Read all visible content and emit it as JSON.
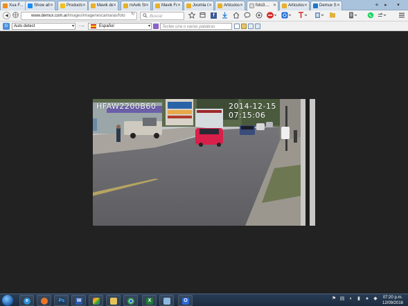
{
  "tabs": [
    {
      "label": "Xua F...",
      "color": "#f28c1c"
    },
    {
      "label": "Show all ...",
      "color": "#1c8cf2"
    },
    {
      "label": "Products",
      "color": "#f2c01c"
    },
    {
      "label": "Mavik del...",
      "color": "#e8b02a"
    },
    {
      "label": "mAvik St...",
      "color": "#e8b02a"
    },
    {
      "label": "Mavik For...",
      "color": "#e8b02a"
    },
    {
      "label": "Joomla G...",
      "color": "#e8b02a"
    },
    {
      "label": "Articulos:...",
      "color": "#e8b02a"
    },
    {
      "label": "foto3....",
      "color": "#f0f0f0",
      "active": true
    },
    {
      "label": "Articulos:...",
      "color": "#e8b02a"
    },
    {
      "label": "Demux S...",
      "color": "#1a78c8"
    }
  ],
  "tab_new": "+",
  "tab_scroll": "▸",
  "tab_menu": "▾",
  "nav": {
    "back": "◀",
    "url_host": "www.demux.com.ar",
    "url_path": "/images/imagenescamaras/foto",
    "reload": "↻",
    "search_placeholder": "Buscar"
  },
  "translate": {
    "logo": "G",
    "source_language": "Auto detect",
    "arrow": "→",
    "target_language": "Español",
    "input_placeholder": "Teclee una o varias palabras"
  },
  "photo_overlay": {
    "camera_id": "HFAW2200B60",
    "timestamp": "2014-12-15 07:15:06"
  },
  "tray": {
    "time": "07:20 p.m.",
    "date": "12/09/2016"
  }
}
